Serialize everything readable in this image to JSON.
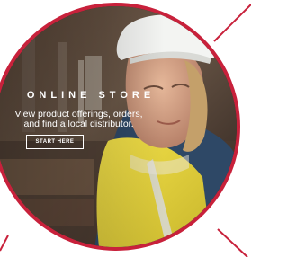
{
  "promo": {
    "title": "ONLINE STORE",
    "body": "View product offerings, orders, and find a local distributor.",
    "button_label": "START HERE"
  },
  "colors": {
    "accent": "#c8213b",
    "text": "#ffffff"
  },
  "icons": {
    "hero_image": "worker-in-hardhat-photo"
  }
}
